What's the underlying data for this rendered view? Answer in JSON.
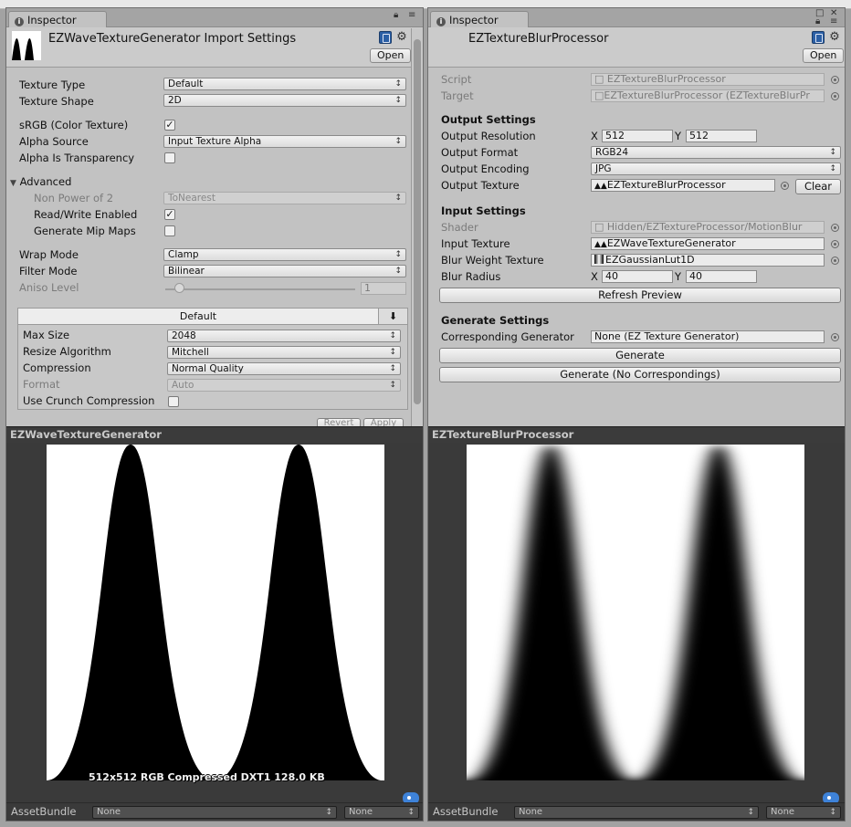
{
  "left": {
    "tab_label": "Inspector",
    "title": "EZWaveTextureGenerator Import Settings",
    "open_label": "Open",
    "rows": {
      "texture_type": {
        "label": "Texture Type",
        "value": "Default"
      },
      "texture_shape": {
        "label": "Texture Shape",
        "value": "2D"
      },
      "srgb": {
        "label": "sRGB (Color Texture)",
        "checked": true
      },
      "alpha_source": {
        "label": "Alpha Source",
        "value": "Input Texture Alpha"
      },
      "alpha_transparency": {
        "label": "Alpha Is Transparency",
        "checked": false
      },
      "advanced": {
        "label": "Advanced"
      },
      "non_power_of_2": {
        "label": "Non Power of 2",
        "value": "ToNearest"
      },
      "read_write": {
        "label": "Read/Write Enabled",
        "checked": true
      },
      "mip_maps": {
        "label": "Generate Mip Maps",
        "checked": false
      },
      "wrap_mode": {
        "label": "Wrap Mode",
        "value": "Clamp"
      },
      "filter_mode": {
        "label": "Filter Mode",
        "value": "Bilinear"
      },
      "aniso_level": {
        "label": "Aniso Level",
        "value": "1"
      }
    },
    "platform": {
      "tab_label": "Default",
      "max_size": {
        "label": "Max Size",
        "value": "2048"
      },
      "resize": {
        "label": "Resize Algorithm",
        "value": "Mitchell"
      },
      "compression": {
        "label": "Compression",
        "value": "Normal Quality"
      },
      "format": {
        "label": "Format",
        "value": "Auto"
      },
      "crunch": {
        "label": "Use Crunch Compression",
        "checked": false
      }
    },
    "revert_label": "Revert",
    "apply_label": "Apply",
    "preview_title": "EZWaveTextureGenerator",
    "preview_stats": "512x512  RGB Compressed DXT1   128.0 KB",
    "assetbundle_label": "AssetBundle",
    "assetbundle_value": "None",
    "assetbundle_variant": "None"
  },
  "right": {
    "tab_label": "Inspector",
    "title": "EZTextureBlurProcessor",
    "open_label": "Open",
    "script": {
      "label": "Script",
      "value": "EZTextureBlurProcessor"
    },
    "target": {
      "label": "Target",
      "value": "EZTextureBlurProcessor (EZTextureBlurPr"
    },
    "output_settings": "Output Settings",
    "output_resolution": {
      "label": "Output Resolution",
      "x_label": "X",
      "x": "512",
      "y_label": "Y",
      "y": "512"
    },
    "output_format": {
      "label": "Output Format",
      "value": "RGB24"
    },
    "output_encoding": {
      "label": "Output Encoding",
      "value": "JPG"
    },
    "output_texture": {
      "label": "Output Texture",
      "value": "EZTextureBlurProcessor",
      "clear_label": "Clear"
    },
    "input_settings": "Input Settings",
    "shader": {
      "label": "Shader",
      "value": "Hidden/EZTextureProcessor/MotionBlur"
    },
    "input_texture": {
      "label": "Input Texture",
      "value": "EZWaveTextureGenerator"
    },
    "blur_weight": {
      "label": "Blur Weight Texture",
      "value": "EZGaussianLut1D"
    },
    "blur_radius": {
      "label": "Blur Radius",
      "x_label": "X",
      "x": "40",
      "y_label": "Y",
      "y": "40"
    },
    "refresh_label": "Refresh Preview",
    "generate_settings": "Generate Settings",
    "corresponding": {
      "label": "Corresponding Generator",
      "value": "None (EZ Texture Generator)"
    },
    "generate_label": "Generate",
    "generate_nc_label": "Generate (No Correspondings)",
    "preview_title": "EZTextureBlurProcessor",
    "assetbundle_label": "AssetBundle",
    "assetbundle_value": "None",
    "assetbundle_variant": "None"
  },
  "colors": {
    "panel": "#c2c2c2",
    "preview_bg": "#3a3a3a",
    "accent": "#3e82d8"
  }
}
